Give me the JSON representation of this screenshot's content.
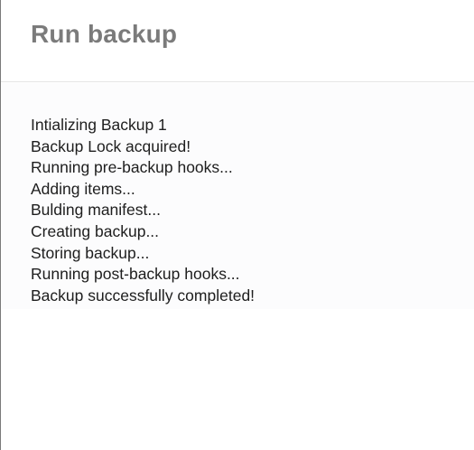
{
  "dialog": {
    "title": "Run backup"
  },
  "log": {
    "lines": [
      "Intializing Backup 1",
      "Backup Lock acquired!",
      "Running pre-backup hooks...",
      "Adding items...",
      "Bulding manifest...",
      "Creating backup...",
      "Storing backup...",
      "Running post-backup hooks...",
      "Backup successfully completed!"
    ]
  }
}
